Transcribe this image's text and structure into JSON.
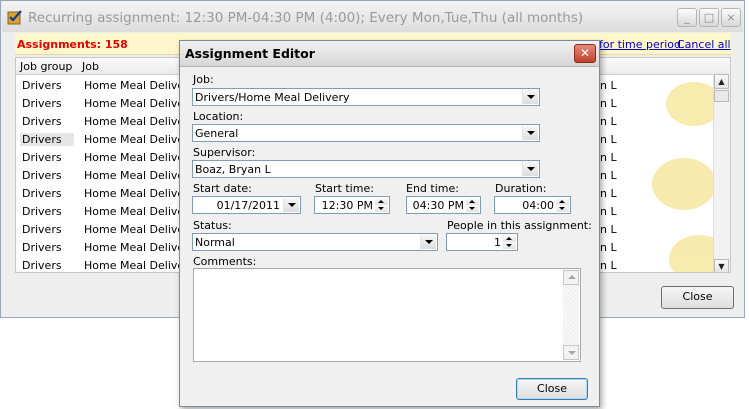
{
  "background_window": {
    "title": "Recurring assignment: 12:30 PM-04:30 PM (4:00); Every Mon,Tue,Thu (all months)",
    "assignments_count": "Assignments: 158",
    "link_time_period": "for time period",
    "link_cancel_all": "Cancel all",
    "columns": [
      "Job group",
      "Job"
    ],
    "right_fragment": "n L",
    "rows": [
      {
        "group": "Drivers",
        "job": "Home Meal Delivery"
      },
      {
        "group": "Drivers",
        "job": "Home Meal Delivery"
      },
      {
        "group": "Drivers",
        "job": "Home Meal Delivery"
      },
      {
        "group": "Drivers",
        "job": "Home Meal Delivery"
      },
      {
        "group": "Drivers",
        "job": "Home Meal Delivery"
      },
      {
        "group": "Drivers",
        "job": "Home Meal Delivery"
      },
      {
        "group": "Drivers",
        "job": "Home Meal Delivery"
      },
      {
        "group": "Drivers",
        "job": "Home Meal Delivery"
      },
      {
        "group": "Drivers",
        "job": "Home Meal Delivery"
      },
      {
        "group": "Drivers",
        "job": "Home Meal Delivery"
      },
      {
        "group": "Drivers",
        "job": "Home Meal Delivery"
      }
    ],
    "close_label": "Close",
    "window_buttons": {
      "minimize": "_",
      "maximize": "□",
      "close": "×"
    }
  },
  "dialog": {
    "title": "Assignment Editor",
    "close_glyph": "✕",
    "job_label": "Job:",
    "job_value": "Drivers/Home Meal Delivery",
    "location_label": "Location:",
    "location_value": "General",
    "supervisor_label": "Supervisor:",
    "supervisor_value": "Boaz, Bryan L",
    "start_date_label": "Start date:",
    "start_date_value": "01/17/2011",
    "start_time_label": "Start time:",
    "start_time_value": "12:30 PM",
    "end_time_label": "End time:",
    "end_time_value": "04:30 PM",
    "duration_label": "Duration:",
    "duration_value": "04:00",
    "status_label": "Status:",
    "status_value": "Normal",
    "people_label": "People in this assignment:",
    "people_value": "1",
    "comments_label": "Comments:",
    "comments_value": "",
    "close_label": "Close"
  },
  "colors": {
    "count_red": "#e80000",
    "link_blue": "#0000cc",
    "bar_yellow": "#fff7cc",
    "dialog_close_red": "#c2412c"
  },
  "icons": [
    "app-icon",
    "minimize-icon",
    "maximize-icon",
    "close-icon",
    "scroll-up-icon",
    "scroll-down-icon",
    "dropdown-arrow-icon",
    "spin-up-icon",
    "spin-down-icon"
  ]
}
